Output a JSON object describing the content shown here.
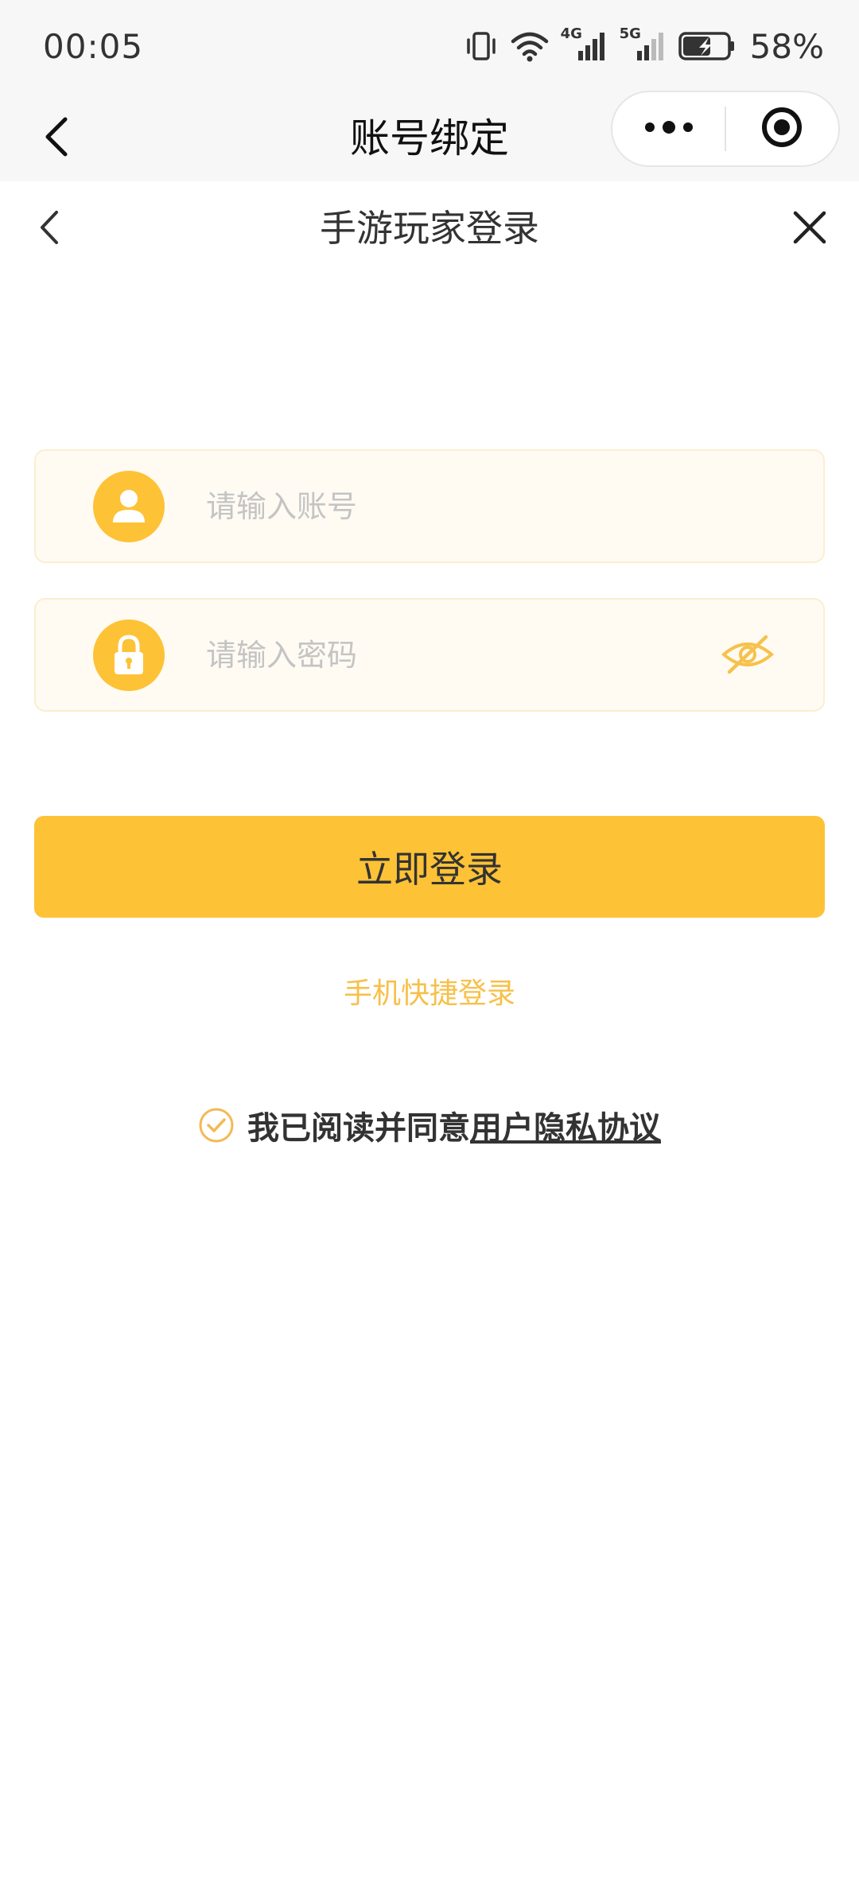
{
  "status_bar": {
    "time": "00:05",
    "network_1": "4G",
    "network_2": "5G",
    "battery": "58%",
    "icons": [
      "vibrate-icon",
      "wifi-icon",
      "signal-4g-icon",
      "signal-5g-icon",
      "battery-charging-icon"
    ]
  },
  "nav": {
    "title": "账号绑定",
    "back_icon": "chevron-left-icon",
    "more_icon": "more-dots-icon",
    "close_icon": "target-circle-icon"
  },
  "page": {
    "title": "手游玩家登录",
    "back_icon": "chevron-left-icon",
    "close_icon": "close-icon"
  },
  "form": {
    "account": {
      "placeholder": "请输入账号",
      "value": "",
      "icon": "user-icon"
    },
    "password": {
      "placeholder": "请输入密码",
      "value": "",
      "icon": "lock-icon",
      "toggle_icon": "eye-off-icon"
    },
    "login_label": "立即登录",
    "quick_login_label": "手机快捷登录"
  },
  "agreement": {
    "checked": true,
    "text": "我已阅读并同意",
    "link": "用户隐私协议"
  },
  "colors": {
    "accent": "#fdc236",
    "quick_login": "#f7c04a",
    "field_bg": "#fffbf3",
    "field_border": "#fbeed0",
    "top_bg": "#f7f7f7"
  }
}
